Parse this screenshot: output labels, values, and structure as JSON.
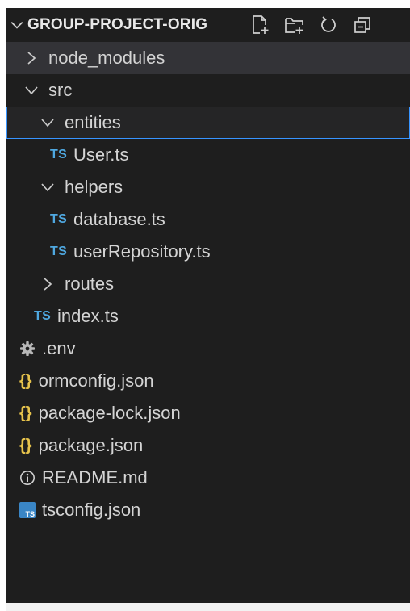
{
  "explorer": {
    "title": "GROUP-PROJECT-ORIG",
    "actions": [
      {
        "name": "new-file-icon"
      },
      {
        "name": "new-folder-icon"
      },
      {
        "name": "refresh-icon"
      },
      {
        "name": "collapse-all-icon"
      }
    ]
  },
  "tree": [
    {
      "label": "node_modules",
      "type": "folder",
      "expanded": false,
      "depth": 0
    },
    {
      "label": "src",
      "type": "folder",
      "expanded": true,
      "depth": 0
    },
    {
      "label": "entities",
      "type": "folder",
      "expanded": true,
      "depth": 1,
      "selected": true
    },
    {
      "label": "User.ts",
      "type": "ts",
      "depth": 2,
      "icon_text": "TS"
    },
    {
      "label": "helpers",
      "type": "folder",
      "expanded": true,
      "depth": 1
    },
    {
      "label": "database.ts",
      "type": "ts",
      "depth": 2,
      "icon_text": "TS"
    },
    {
      "label": "userRepository.ts",
      "type": "ts",
      "depth": 2,
      "icon_text": "TS"
    },
    {
      "label": "routes",
      "type": "folder",
      "expanded": false,
      "depth": 1
    },
    {
      "label": "index.ts",
      "type": "ts",
      "depth": 1,
      "icon_text": "TS"
    },
    {
      "label": ".env",
      "type": "env",
      "depth": 0
    },
    {
      "label": "ormconfig.json",
      "type": "json",
      "depth": 0,
      "icon_text": "{}"
    },
    {
      "label": "package-lock.json",
      "type": "json",
      "depth": 0,
      "icon_text": "{}"
    },
    {
      "label": "package.json",
      "type": "json",
      "depth": 0,
      "icon_text": "{}"
    },
    {
      "label": "README.md",
      "type": "info",
      "depth": 0
    },
    {
      "label": "tsconfig.json",
      "type": "tsconfig",
      "depth": 0,
      "icon_text": "TS"
    }
  ],
  "colors": {
    "panel_bg": "#1e1e1e",
    "focus_border": "#3794ff",
    "ts_blue": "#4fa8e0",
    "json_yellow": "#e8c44c"
  }
}
